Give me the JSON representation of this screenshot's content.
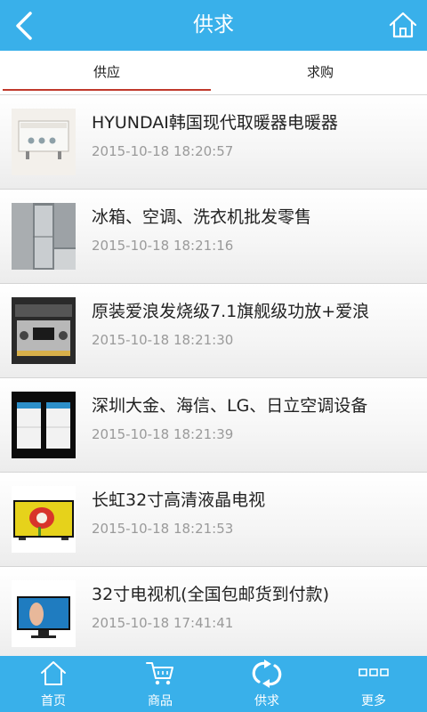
{
  "header": {
    "title": "供求"
  },
  "tabs": [
    {
      "label": "供应",
      "active": true
    },
    {
      "label": "求购",
      "active": false
    }
  ],
  "items": [
    {
      "name": "HYUNDAI韩国现代取暖器电暖器",
      "date": "2015-10-18 18:20:57",
      "icon": "heater-thumbnail"
    },
    {
      "name": "冰箱、空调、洗衣机批发零售",
      "date": "2015-10-18 18:21:16",
      "icon": "appliances-thumbnail"
    },
    {
      "name": "原装爱浪发烧级7.1旗舰级功放+爱浪",
      "date": "2015-10-18 18:21:30",
      "icon": "amplifier-thumbnail"
    },
    {
      "name": "深圳大金、海信、LG、日立空调设备",
      "date": "2015-10-18 18:21:39",
      "icon": "ac-units-thumbnail"
    },
    {
      "name": "长虹32寸高清液晶电视",
      "date": "2015-10-18 18:21:53",
      "icon": "tv-thumbnail"
    },
    {
      "name": "32寸电视机(全国包邮货到付款)",
      "date": "2015-10-18 17:41:41",
      "icon": "tv-thumbnail"
    }
  ],
  "tabbar": [
    {
      "label": "首页",
      "icon": "home-icon"
    },
    {
      "label": "商品",
      "icon": "cart-icon"
    },
    {
      "label": "供求",
      "icon": "refresh-icon"
    },
    {
      "label": "更多",
      "icon": "more-icon"
    }
  ],
  "colors": {
    "accent": "#39b0ea",
    "active_tab_underline": "#c0392b",
    "date_text": "#9a9a9a"
  }
}
